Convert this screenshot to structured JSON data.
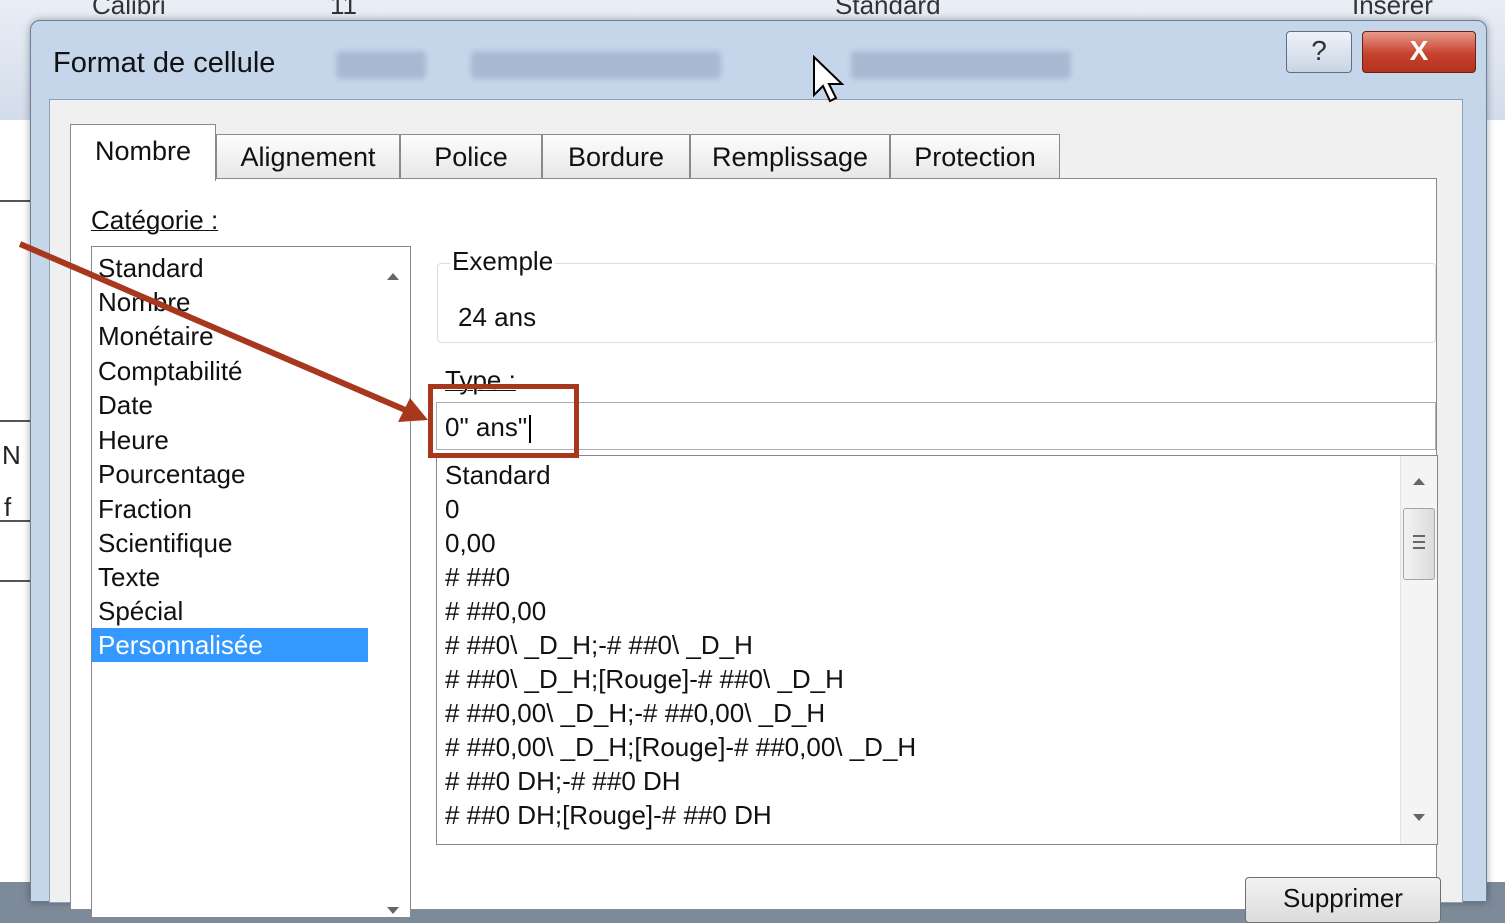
{
  "background": {
    "ribbon_texts": [
      "Calibri",
      "11",
      "Standard",
      "Insérer"
    ],
    "sheet_cells": [
      "N",
      "f"
    ]
  },
  "dialog": {
    "title": "Format de cellule",
    "help_label": "?",
    "close_label": "X",
    "tabs": [
      {
        "label": "Nombre",
        "active": true
      },
      {
        "label": "Alignement"
      },
      {
        "label": "Police"
      },
      {
        "label": "Bordure"
      },
      {
        "label": "Remplissage"
      },
      {
        "label": "Protection"
      }
    ],
    "category": {
      "label": "Catégorie :",
      "items": [
        "Standard",
        "Nombre",
        "Monétaire",
        "Comptabilité",
        "Date",
        "Heure",
        "Pourcentage",
        "Fraction",
        "Scientifique",
        "Texte",
        "Spécial",
        "Personnalisée"
      ],
      "selected": "Personnalisée"
    },
    "example": {
      "label": "Exemple",
      "value": "24 ans"
    },
    "type": {
      "label": "Type :",
      "value": "0\" ans\""
    },
    "formats": [
      "Standard",
      "0",
      "0,00",
      "# ##0",
      "# ##0,00",
      "# ##0\\ _D_H;-# ##0\\ _D_H",
      "# ##0\\ _D_H;[Rouge]-# ##0\\ _D_H",
      "# ##0,00\\ _D_H;-# ##0,00\\ _D_H",
      "# ##0,00\\ _D_H;[Rouge]-# ##0,00\\ _D_H",
      "# ##0 DH;-# ##0 DH",
      "# ##0 DH;[Rouge]-# ##0 DH"
    ],
    "delete_button": "Supprimer"
  },
  "colors": {
    "annotation": "#a8381d",
    "selection": "#3399ff",
    "close_button": "#c6422d"
  }
}
